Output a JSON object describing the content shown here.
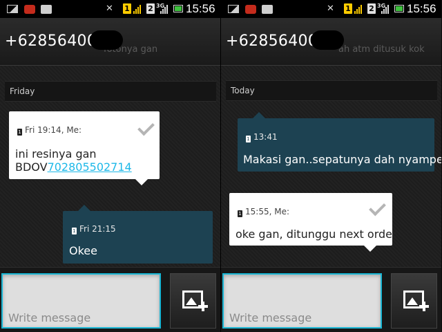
{
  "status": {
    "sim1": "1",
    "sim2": "2",
    "net": "3G",
    "time": "15:56"
  },
  "panes": [
    {
      "contact": "+628564005",
      "ghost_text": "fotonya gan",
      "day_header": "Friday",
      "messages": [
        {
          "meta": "Fri 19:14, Me:",
          "line1": "ini resinya gan",
          "line2_prefix": "BDOV",
          "line2_link": "702805502714",
          "sent_by_me": true
        },
        {
          "meta": "Fri 21:15",
          "text": "Okee",
          "sent_by_me": false
        }
      ],
      "placeholder": "Write message"
    },
    {
      "contact": "+628564005",
      "ghost_text": "ah atm ditusuk kok",
      "day_header": "Today",
      "messages": [
        {
          "meta": "13:41",
          "text": "Makasi gan..sepatunya dah nyampe",
          "sent_by_me": false
        },
        {
          "meta": "15:55, Me:",
          "text": "oke gan, ditunggu next order",
          "sent_by_me": true
        }
      ],
      "placeholder": "Write message"
    }
  ],
  "colors": {
    "accent": "#19b7d5",
    "incoming_bubble": "#1d4252",
    "outgoing_bubble": "#ffffff",
    "link": "#1cb8e8"
  },
  "icons": {
    "attach": "add-picture-icon",
    "delivered": "check-icon"
  }
}
